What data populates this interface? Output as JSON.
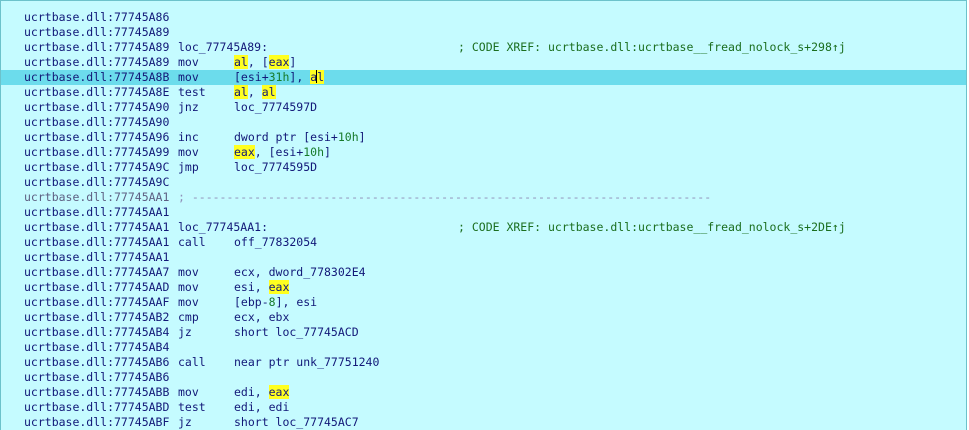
{
  "listing": [
    {
      "addr": "ucrtbase.dll:77745A86"
    },
    {
      "addr": "ucrtbase.dll:77745A89"
    },
    {
      "addr": "ucrtbase.dll:77745A89",
      "label": "loc_77745A89:",
      "comment": "; CODE XREF: ucrtbase.dll:ucrtbase__fread_nolock_s+298↑j"
    },
    {
      "addr": "ucrtbase.dll:77745A89",
      "mnem": "mov",
      "ops": [
        {
          "t": "al",
          "hl": true
        },
        {
          "t": ", ["
        },
        {
          "t": "eax",
          "hl": true
        },
        {
          "t": "]"
        }
      ]
    },
    {
      "addr": "ucrtbase.dll:77745A8B",
      "selected": true,
      "mnem": "mov",
      "ops": [
        {
          "t": "[esi+"
        },
        {
          "t": "31h",
          "num": true
        },
        {
          "t": "], "
        },
        {
          "t": "a",
          "hl": true
        },
        {
          "caret": true
        },
        {
          "t": "l",
          "hl": true
        }
      ]
    },
    {
      "addr": "ucrtbase.dll:77745A8E",
      "mnem": "test",
      "ops": [
        {
          "t": "al",
          "hl": true
        },
        {
          "t": ", "
        },
        {
          "t": "al",
          "hl": true
        }
      ]
    },
    {
      "addr": "ucrtbase.dll:77745A90",
      "mnem": "jnz",
      "ops": [
        {
          "t": "loc_7774597D"
        }
      ]
    },
    {
      "addr": "ucrtbase.dll:77745A90"
    },
    {
      "addr": "ucrtbase.dll:77745A96",
      "mnem": "inc",
      "ops": [
        {
          "t": "dword ptr [esi+"
        },
        {
          "t": "10h",
          "num": true
        },
        {
          "t": "]"
        }
      ]
    },
    {
      "addr": "ucrtbase.dll:77745A99",
      "mnem": "mov",
      "ops": [
        {
          "t": "eax",
          "hl": true
        },
        {
          "t": ", [esi+"
        },
        {
          "t": "10h",
          "num": true
        },
        {
          "t": "]"
        }
      ]
    },
    {
      "addr": "ucrtbase.dll:77745A9C",
      "mnem": "jmp",
      "ops": [
        {
          "t": "loc_7774595D"
        }
      ]
    },
    {
      "addr": "ucrtbase.dll:77745A9C"
    },
    {
      "addr": "ucrtbase.dll:77745AA1",
      "gray": true,
      "sep": "; ---------------------------------------------------------------------------"
    },
    {
      "addr": "ucrtbase.dll:77745AA1"
    },
    {
      "addr": "ucrtbase.dll:77745AA1",
      "label": "loc_77745AA1:",
      "comment": "; CODE XREF: ucrtbase.dll:ucrtbase__fread_nolock_s+2DE↑j"
    },
    {
      "addr": "ucrtbase.dll:77745AA1",
      "mnem": "call",
      "ops": [
        {
          "t": "off_77832054"
        }
      ]
    },
    {
      "addr": "ucrtbase.dll:77745AA1"
    },
    {
      "addr": "ucrtbase.dll:77745AA7",
      "mnem": "mov",
      "ops": [
        {
          "t": "ecx, dword_778302E4"
        }
      ]
    },
    {
      "addr": "ucrtbase.dll:77745AAD",
      "mnem": "mov",
      "ops": [
        {
          "t": "esi, "
        },
        {
          "t": "eax",
          "hl": true
        }
      ]
    },
    {
      "addr": "ucrtbase.dll:77745AAF",
      "mnem": "mov",
      "ops": [
        {
          "t": "[ebp-"
        },
        {
          "t": "8",
          "num": true
        },
        {
          "t": "], esi"
        }
      ]
    },
    {
      "addr": "ucrtbase.dll:77745AB2",
      "mnem": "cmp",
      "ops": [
        {
          "t": "ecx, ebx"
        }
      ]
    },
    {
      "addr": "ucrtbase.dll:77745AB4",
      "mnem": "jz",
      "ops": [
        {
          "t": "short loc_77745ACD"
        }
      ]
    },
    {
      "addr": "ucrtbase.dll:77745AB4"
    },
    {
      "addr": "ucrtbase.dll:77745AB6",
      "mnem": "call",
      "ops": [
        {
          "t": "near ptr unk_77751240"
        }
      ]
    },
    {
      "addr": "ucrtbase.dll:77745AB6"
    },
    {
      "addr": "ucrtbase.dll:77745ABB",
      "mnem": "mov",
      "ops": [
        {
          "t": "edi, "
        },
        {
          "t": "eax",
          "hl": true
        }
      ]
    },
    {
      "addr": "ucrtbase.dll:77745ABD",
      "mnem": "test",
      "ops": [
        {
          "t": "edi, edi"
        }
      ]
    },
    {
      "addr": "ucrtbase.dll:77745ABF",
      "mnem": "jz",
      "ops": [
        {
          "t": "short loc_77745AC7"
        }
      ]
    }
  ],
  "colors": {
    "background": "#c5fbff",
    "selected_line": "#6cdcec",
    "register_highlight": "#ffff20",
    "text": "#121878",
    "comment": "#1b6e1f",
    "number": "#177a2a"
  }
}
